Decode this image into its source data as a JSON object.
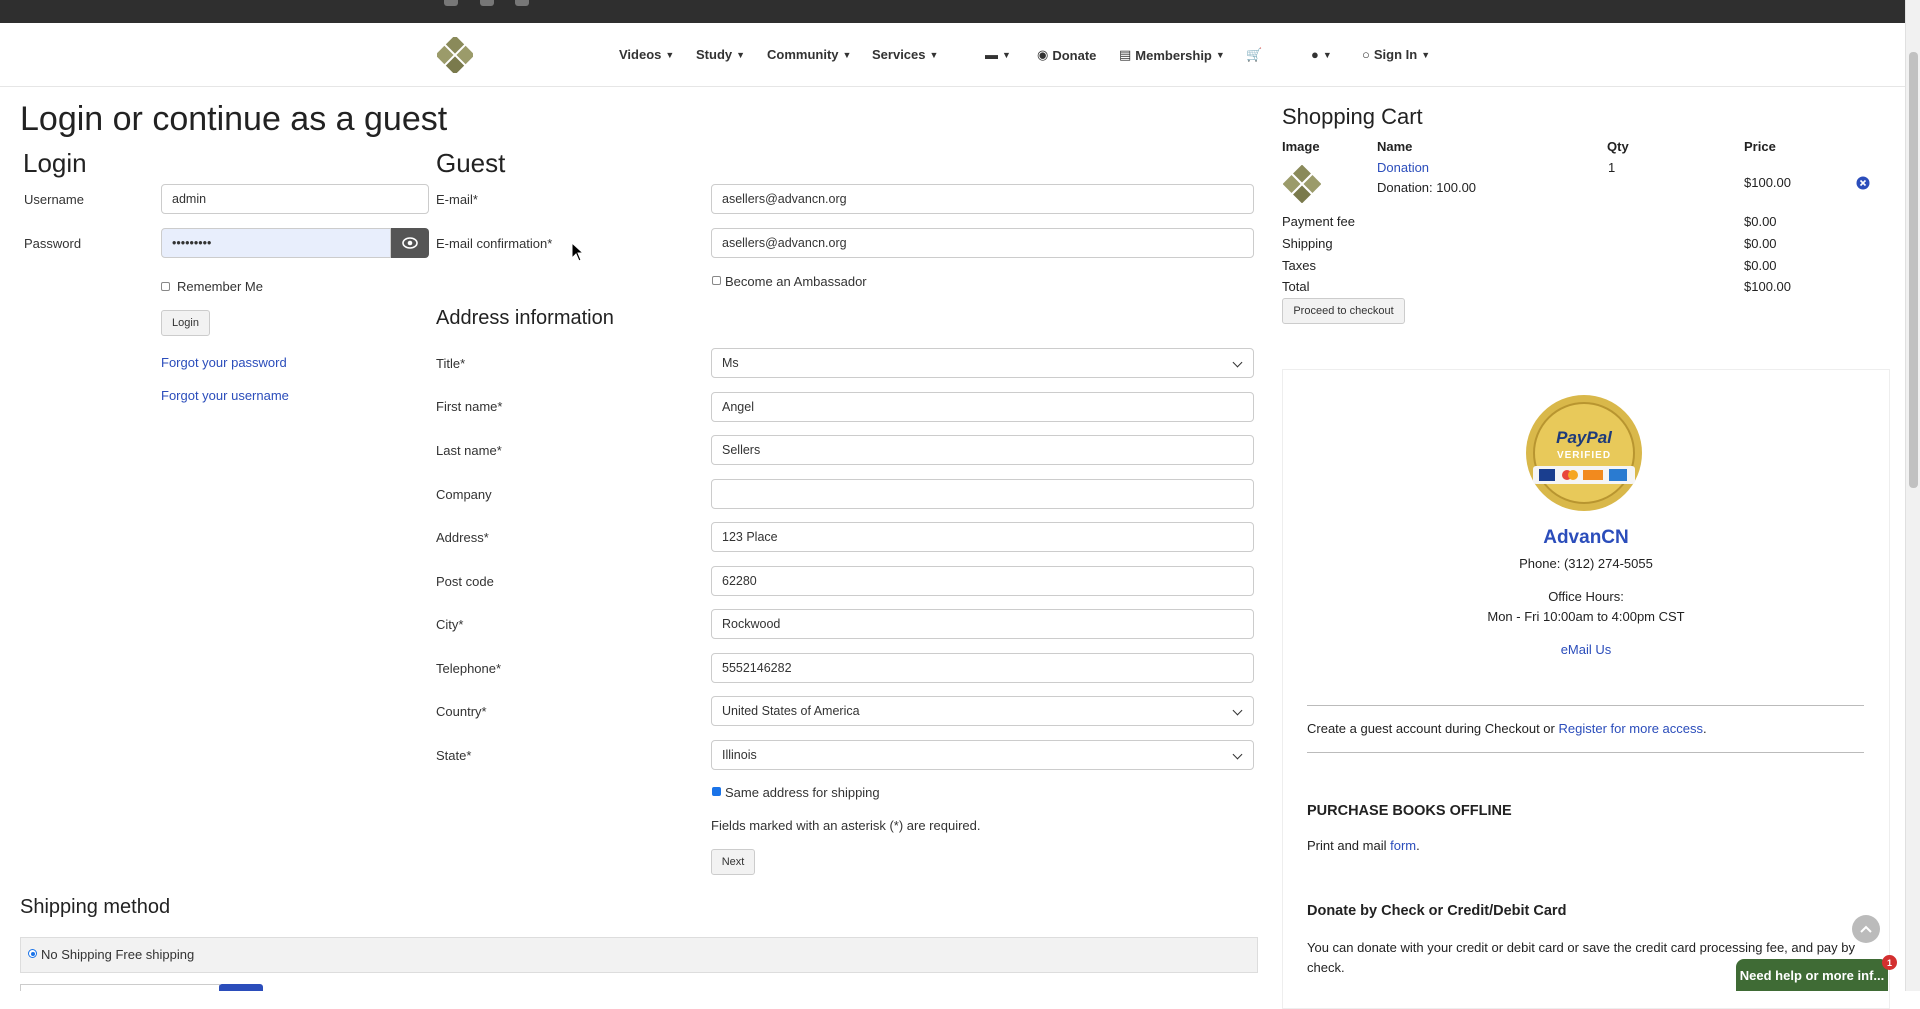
{
  "nav": {
    "items": [
      {
        "label": "Videos"
      },
      {
        "label": "Study"
      },
      {
        "label": "Community"
      },
      {
        "label": "Services"
      },
      {
        "label": "Donate"
      },
      {
        "label": "Membership"
      },
      {
        "label": "Sign In"
      }
    ]
  },
  "page": {
    "title": "Login or continue as a guest"
  },
  "login": {
    "heading": "Login",
    "username_label": "Username",
    "username_value": "admin",
    "password_label": "Password",
    "password_value": "•••••••••",
    "remember_label": "Remember Me",
    "login_button": "Login",
    "forgot_password": "Forgot your password",
    "forgot_username": "Forgot your username"
  },
  "guest": {
    "heading": "Guest",
    "email_label": "E-mail*",
    "email_value": "asellers@advancn.org",
    "email_confirm_label": "E-mail confirmation*",
    "email_confirm_value": "asellers@advancn.org",
    "ambassador_label": "Become an Ambassador"
  },
  "address": {
    "heading": "Address information",
    "title_label": "Title*",
    "title_value": "Ms",
    "first_label": "First name*",
    "first_value": "Angel",
    "last_label": "Last name*",
    "last_value": "Sellers",
    "company_label": "Company",
    "company_value": "",
    "address_label": "Address*",
    "address_value": "123 Place",
    "post_label": "Post code",
    "post_value": "62280",
    "city_label": "City*",
    "city_value": "Rockwood",
    "tel_label": "Telephone*",
    "tel_value": "5552146282",
    "country_label": "Country*",
    "country_value": "United States of America",
    "state_label": "State*",
    "state_value": "Illinois",
    "same_address_label": "Same address for shipping",
    "required_note": "Fields marked with an asterisk (*) are required.",
    "next_button": "Next"
  },
  "shipping": {
    "heading": "Shipping method",
    "option": "No Shipping Free shipping"
  },
  "cart": {
    "heading": "Shopping Cart",
    "columns": {
      "image": "Image",
      "name": "Name",
      "qty": "Qty",
      "price": "Price"
    },
    "item": {
      "name": "Donation",
      "detail": "Donation: 100.00",
      "qty": "1",
      "price": "$100.00"
    },
    "summary": [
      {
        "label": "Payment fee",
        "value": "$0.00"
      },
      {
        "label": "Shipping",
        "value": "$0.00"
      },
      {
        "label": "Taxes",
        "value": "$0.00"
      },
      {
        "label": "Total",
        "value": "$100.00"
      }
    ],
    "checkout_button": "Proceed to checkout"
  },
  "sidebar": {
    "badge_top": "PayPal",
    "badge_bottom": "VERIFIED",
    "org_name": "AdvanCN",
    "phone": "Phone: (312) 274-5055",
    "hours_label": "Office Hours:",
    "hours": "Mon - Fri 10:00am to 4:00pm CST",
    "email_link": "eMail Us",
    "guest_text": "Create a guest account during Checkout or",
    "register_link": "Register for more access",
    "purchase_heading": "PURCHASE BOOKS OFFLINE",
    "purchase_text": "Print and mail",
    "form_link": "form",
    "donate_heading": "Donate by Check or Credit/Debit Card",
    "donate_text": "You can donate with your credit or debit card or save the credit card processing fee, and pay by check."
  },
  "help": {
    "label": "Need help or more inf...",
    "badge": "1"
  },
  "colors": {
    "accent": "#2b4dbb",
    "help": "#3f6b35",
    "topbar": "#2f2f2f"
  }
}
